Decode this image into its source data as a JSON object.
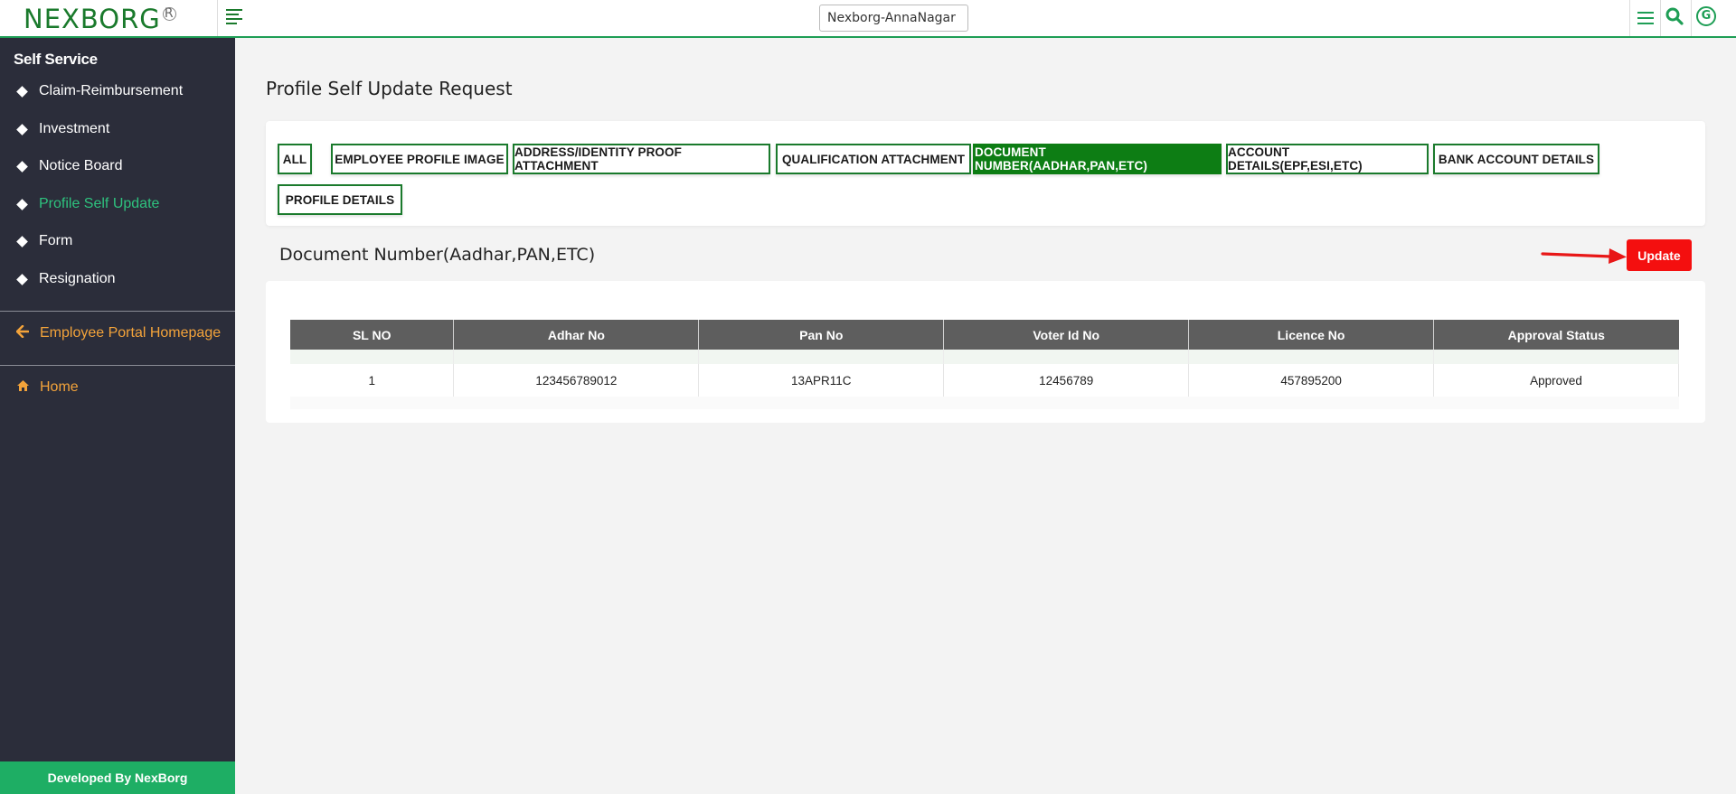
{
  "header": {
    "logo_part1": "NEXBORG",
    "logo_reg": "R",
    "branch_value": "Nexborg-AnnaNagar",
    "avatar_letter": "G"
  },
  "sidebar": {
    "heading": "Self Service",
    "items": [
      {
        "label": "Claim-Reimbursement"
      },
      {
        "label": "Investment"
      },
      {
        "label": "Notice Board"
      },
      {
        "label": "Profile Self Update"
      },
      {
        "label": "Form"
      },
      {
        "label": "Resignation"
      }
    ],
    "portal_link": "Employee Portal Homepage",
    "home_link": "Home",
    "footer": "Developed By NexBorg"
  },
  "main": {
    "page_title": "Profile Self Update Request",
    "tabs": [
      {
        "label": "ALL"
      },
      {
        "label": "EMPLOYEE PROFILE IMAGE"
      },
      {
        "label": "ADDRESS/IDENTITY PROOF ATTACHMENT"
      },
      {
        "label": "QUALIFICATION ATTACHMENT"
      },
      {
        "label": "DOCUMENT NUMBER(AADHAR,PAN,ETC)"
      },
      {
        "label": "ACCOUNT DETAILS(EPF,ESI,ETC)"
      },
      {
        "label": "BANK ACCOUNT DETAILS"
      },
      {
        "label": "PROFILE DETAILS"
      }
    ],
    "active_tab": "DOCUMENT NUMBER(AADHAR,PAN,ETC)",
    "section_title": "Document Number(Aadhar,PAN,ETC)",
    "update_label": "Update",
    "table": {
      "columns": [
        "SL NO",
        "Adhar No",
        "Pan No",
        "Voter Id No",
        "Licence No",
        "Approval Status"
      ],
      "rows": [
        [
          "1",
          "123456789012",
          "13APR11C",
          "12456789",
          "457895200",
          "Approved"
        ]
      ]
    }
  },
  "colors": {
    "brand_green": "#1a7a2c",
    "active_tab": "#0d7d14",
    "sidebar_bg": "#2b2d3a",
    "sidebar_active": "#2ec27e",
    "link_orange": "#f3a33a",
    "update_red": "#f40f0f",
    "footer_green": "#1eae64"
  },
  "icons": {
    "toggle": "menu-align-left-icon",
    "menu": "hamburger-icon",
    "search": "search-icon",
    "avatar": "user-avatar-icon",
    "portal": "arrow-left-icon",
    "home": "home-icon",
    "annotation": "red-arrow-icon"
  }
}
